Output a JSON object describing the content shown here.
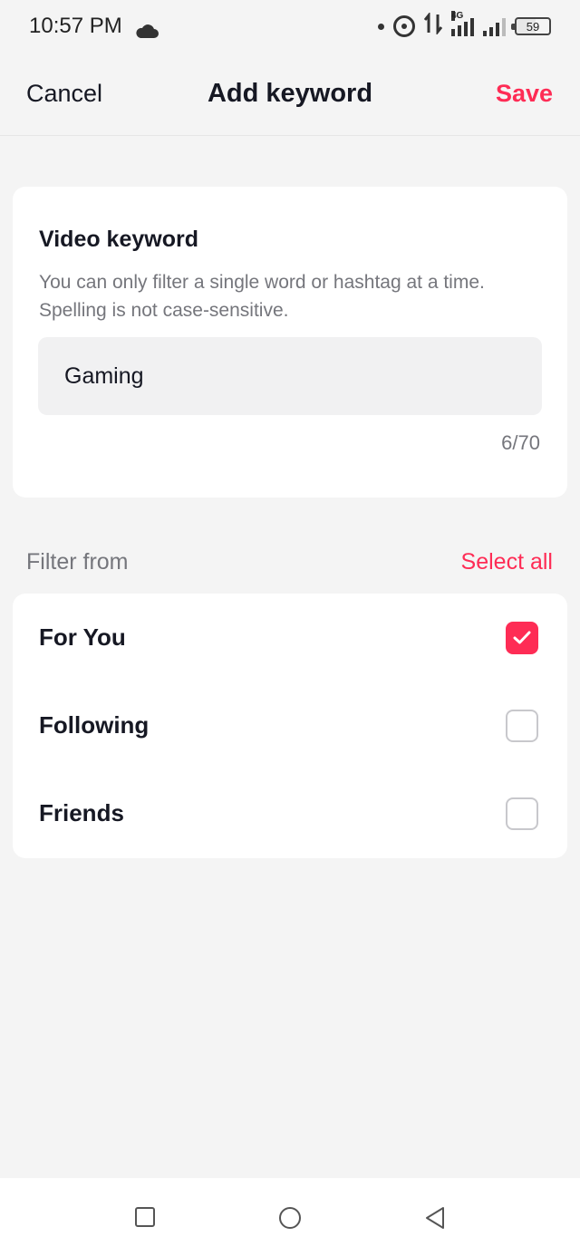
{
  "status_bar": {
    "time": "10:57 PM",
    "network_type": "4G",
    "battery_level": "59",
    "icons": [
      "cloud-icon",
      "dot-icon",
      "hotspot-icon",
      "data-arrows-icon",
      "signal-4g-icon",
      "signal-icon",
      "battery-icon"
    ]
  },
  "header": {
    "cancel_label": "Cancel",
    "title": "Add keyword",
    "save_label": "Save"
  },
  "keyword_card": {
    "title": "Video keyword",
    "description": "You can only filter a single word or hashtag at a time. Spelling is not case-sensitive.",
    "input_value": "Gaming",
    "char_count": "6/70"
  },
  "filter_section": {
    "label": "Filter from",
    "select_all_label": "Select all",
    "options": [
      {
        "label": "For You",
        "checked": true
      },
      {
        "label": "Following",
        "checked": false
      },
      {
        "label": "Friends",
        "checked": false
      }
    ]
  },
  "system_nav": {
    "icons": [
      "recents-square-icon",
      "home-circle-icon",
      "back-triangle-icon"
    ]
  },
  "colors": {
    "accent": "#fe2c55",
    "background": "#f4f4f4",
    "card": "#ffffff",
    "secondary_text": "#75767c"
  }
}
